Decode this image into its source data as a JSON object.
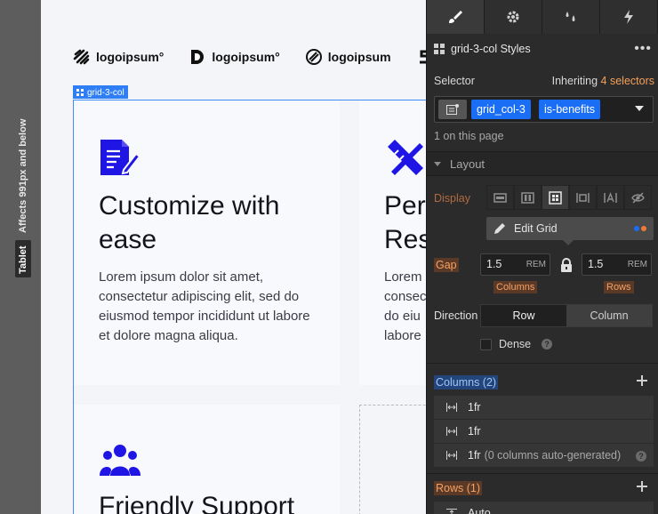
{
  "rail": {
    "affects": "Affects 991px and below",
    "device": "Tablet"
  },
  "canvas": {
    "logos": [
      "logoipsum°",
      "logoipsum°",
      "logoipsum"
    ],
    "grid_tag": "grid-3-col",
    "cards": [
      {
        "title": "Customize with ease",
        "body": "Lorem ipsum dolor sit amet, consectetur adipiscing elit, sed do eiusmod tempor incididunt ut labore et dolore magna aliqua.",
        "icon": "document-edit-icon"
      },
      {
        "title": "Per… Res…",
        "body": "Lorem… consec… do eiu… labore…",
        "icon": "pencil-ruler-icon"
      },
      {
        "title": "Friendly Support",
        "body": "",
        "icon": "users-icon"
      }
    ],
    "card2_title_lines": [
      "Per",
      "Res"
    ],
    "card2_body_lines": [
      "Lorem",
      "consec",
      "do eiu",
      "labore"
    ]
  },
  "panel": {
    "tabs": [
      "style-brush-icon",
      "settings-gear-icon",
      "interactions-drops-icon",
      "lightning-icon"
    ],
    "header": "grid-3-col Styles",
    "selector_label": "Selector",
    "inheriting_label": "Inheriting",
    "inheriting_count": "4 selectors",
    "chips": [
      "grid_col-3",
      "is-benefits"
    ],
    "on_page": "1 on this page",
    "layout_title": "Layout",
    "display_label": "Display",
    "edit_grid": "Edit Grid",
    "gap_label": "Gap",
    "gap_columns": {
      "value": "1.5",
      "unit": "REM",
      "label": "Columns"
    },
    "gap_rows": {
      "value": "1.5",
      "unit": "REM",
      "label": "Rows"
    },
    "direction_label": "Direction",
    "direction_options": [
      "Row",
      "Column"
    ],
    "dense_label": "Dense",
    "columns_label": "Columns (2)",
    "columns": [
      {
        "value": "1fr",
        "note": ""
      },
      {
        "value": "1fr",
        "note": ""
      },
      {
        "value": "1fr",
        "note": "(0 columns auto-generated)"
      }
    ],
    "rows_label": "Rows (1)",
    "rows": [
      {
        "value": "Auto"
      }
    ],
    "colors": {
      "accent": "#1a6ef5",
      "orange": "#f6a064",
      "panel": "#2b2b2b"
    }
  }
}
